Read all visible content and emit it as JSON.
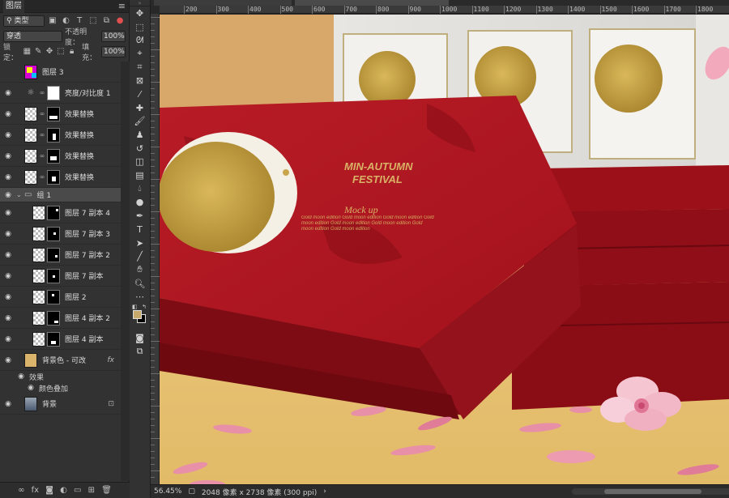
{
  "layers_panel": {
    "tab_title": "图层",
    "filter_label": "类型",
    "blend_mode": "穿透",
    "opacity_label": "不透明度：",
    "opacity_value": "100%",
    "lock_label": "锁定：",
    "fill_label": "填充：",
    "fill_value": "100%",
    "layers": [
      {
        "name": "图层 3",
        "visible": false,
        "thumb_color": "#d400d4"
      },
      {
        "name": "亮度/对比度 1",
        "visible": true
      },
      {
        "name": "效果替换",
        "visible": true
      },
      {
        "name": "效果替换",
        "visible": true
      },
      {
        "name": "效果替换",
        "visible": true
      },
      {
        "name": "效果替换",
        "visible": true
      },
      {
        "name": "组 1",
        "visible": true
      },
      {
        "name": "图层 7 副本 4",
        "visible": true
      },
      {
        "name": "图层 7 副本 3",
        "visible": true
      },
      {
        "name": "图层 7 副本 2",
        "visible": true
      },
      {
        "name": "图层 7 副本",
        "visible": true
      },
      {
        "name": "图层 2",
        "visible": true
      },
      {
        "name": "图层 4 副本 2",
        "visible": true
      },
      {
        "name": "图层 4 副本",
        "visible": true
      },
      {
        "name": "背景色 - 可改",
        "visible": true,
        "fx": "fx"
      },
      {
        "name": "效果",
        "visible": true
      },
      {
        "name": "颜色叠加",
        "visible": true
      },
      {
        "name": "背景",
        "visible": true
      }
    ]
  },
  "canvas": {
    "box_title_line1": "MIN-AUTUMN",
    "box_title_line2": "FESTIVAL",
    "box_subtitle": "Mock up",
    "box_body": "Gold moon edition Gold moon edition Gold moon edition Gold moon edition Gold moon edition Gold moon edition Gold moon edition Gold moon edition",
    "colors": {
      "box_red": "#b01a22",
      "gold": "#c9a44a",
      "table": "#e8c572"
    }
  },
  "ruler": {
    "labels": [
      "200",
      "300",
      "400",
      "500",
      "600",
      "700",
      "800",
      "900",
      "1000",
      "1100",
      "1200",
      "1300",
      "1400",
      "1500",
      "1600",
      "1700",
      "1800"
    ]
  },
  "status": {
    "zoom": "56.45%",
    "doc_size": "2048 像素 x 2738 像素 (300 ppi)"
  }
}
